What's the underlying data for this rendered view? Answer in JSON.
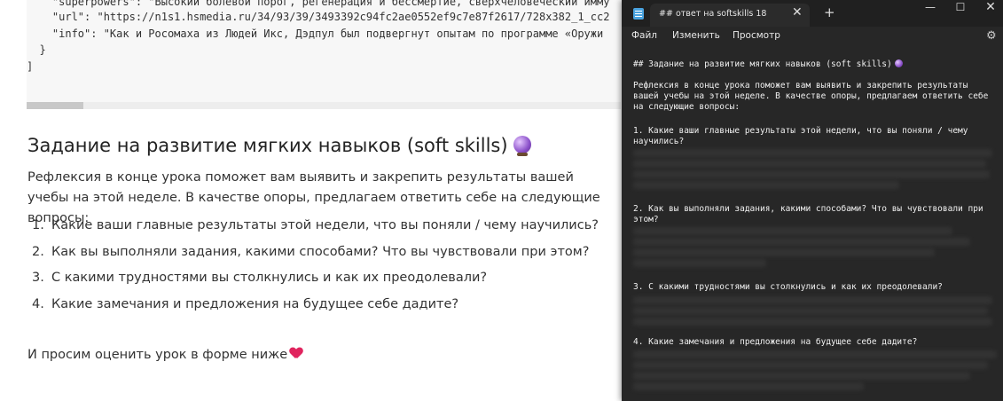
{
  "code": {
    "lines": [
      "    \"superpowers\": \"Высокий болевой порог, регенерация и бессмертие, сверхчеловеческий имму",
      "    \"url\": \"https://n1s1.hsmedia.ru/34/93/39/3493392c94fc2ae0552ef9c7e87f2617/728x382_1_cc2",
      "    \"info\": \"Как и Росомаха из Людей Икс, Дэдпул был подвергнут опытам по программе «Оружи",
      "  }",
      "]"
    ]
  },
  "markdown": {
    "title": "Задание на развитие мягких навыков (soft skills)",
    "title_icon": "crystal-ball-icon",
    "intro": "Рефлексия в конце урока поможет вам выявить и закрепить результаты вашей учебы на этой неделе. В качестве опоры, предлагаем ответить себе на следующие вопросы:",
    "questions": [
      {
        "num": "1.",
        "text": "Какие ваши главные результаты этой недели, что вы поняли / чему научились?"
      },
      {
        "num": "2.",
        "text": "Как вы выполняли задания, какими способами? Что вы чувствовали при этом?"
      },
      {
        "num": "3.",
        "text": "С какими трудностями вы столкнулись и как их преодолевали?"
      },
      {
        "num": "4.",
        "text": "Какие замечания и предложения на будущее себе дадите?"
      }
    ],
    "final": "И просим оценить урок в форме ниже",
    "final_icon": "heart-icon"
  },
  "notepad": {
    "tab_title": "## ответ на softskills 18",
    "tab_close": "✕",
    "tab_add": "+",
    "win_min": "—",
    "win_max": "☐",
    "win_close": "✕",
    "menu": [
      "Файл",
      "Изменить",
      "Просмотр"
    ],
    "settings_icon": "gear-icon",
    "lines": {
      "heading": "## Задание на развитие мягких навыков (soft skills)",
      "intro1": "Рефлексия в конце урока поможет вам выявить и закрепить результаты",
      "intro2": "вашей учебы на этой неделе. В качестве опоры, предлагаем ответить себе",
      "intro3": "на следующие вопросы:",
      "q1a": "1. Какие ваши главные результаты этой недели, что вы поняли / чему",
      "q1b": "научились?",
      "q2a": "2. Как вы выполняли задания, какими способами? Что вы чувствовали при",
      "q2b": "этом?",
      "q3": "3. С какими трудностями вы столкнулись и как их преодолевали?",
      "q4": "4. Какие замечания и предложения на будущее себе дадите?"
    }
  }
}
